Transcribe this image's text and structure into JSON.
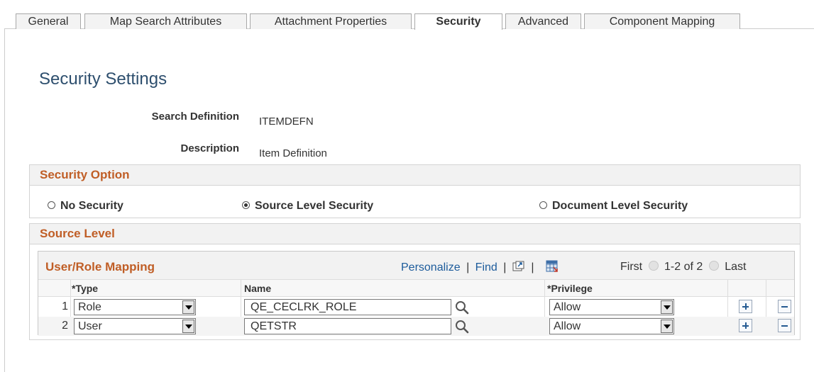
{
  "tabs": [
    {
      "label": "General",
      "active": false
    },
    {
      "label": "Map Search Attributes",
      "active": false
    },
    {
      "label": "Attachment Properties",
      "active": false
    },
    {
      "label": "Security",
      "active": true
    },
    {
      "label": "Advanced",
      "active": false
    },
    {
      "label": "Component Mapping",
      "active": false
    }
  ],
  "page_title": "Security Settings",
  "fields": {
    "search_definition_label": "Search Definition",
    "search_definition_value": "ITEMDEFN",
    "description_label": "Description",
    "description_value": "Item Definition"
  },
  "security_option": {
    "title": "Security Option",
    "options": [
      {
        "label": "No Security",
        "checked": false
      },
      {
        "label": "Source Level Security",
        "checked": true
      },
      {
        "label": "Document Level Security",
        "checked": false
      }
    ]
  },
  "source_level": {
    "title": "Source Level"
  },
  "grid": {
    "title": "User/Role Mapping",
    "personalize": "Personalize",
    "find": "Find",
    "sep": "|",
    "first": "First",
    "range": "1-2 of 2",
    "last": "Last",
    "columns": {
      "type": "*Type",
      "name": "Name",
      "privilege": "*Privilege"
    },
    "rows": [
      {
        "num": "1",
        "type": "Role",
        "name": "QE_CECLRK_ROLE",
        "privilege": "Allow"
      },
      {
        "num": "2",
        "type": "User",
        "name": "QETSTR",
        "privilege": "Allow"
      }
    ]
  },
  "colors": {
    "section_title": "#c05e26",
    "page_title": "#2e4f6e",
    "link": "#1c5b9b"
  },
  "icons": {
    "lookup": "magnifier-icon",
    "add": "plus-icon",
    "delete": "minus-icon",
    "zoom": "view-all-icon",
    "download": "grid-download-icon"
  }
}
